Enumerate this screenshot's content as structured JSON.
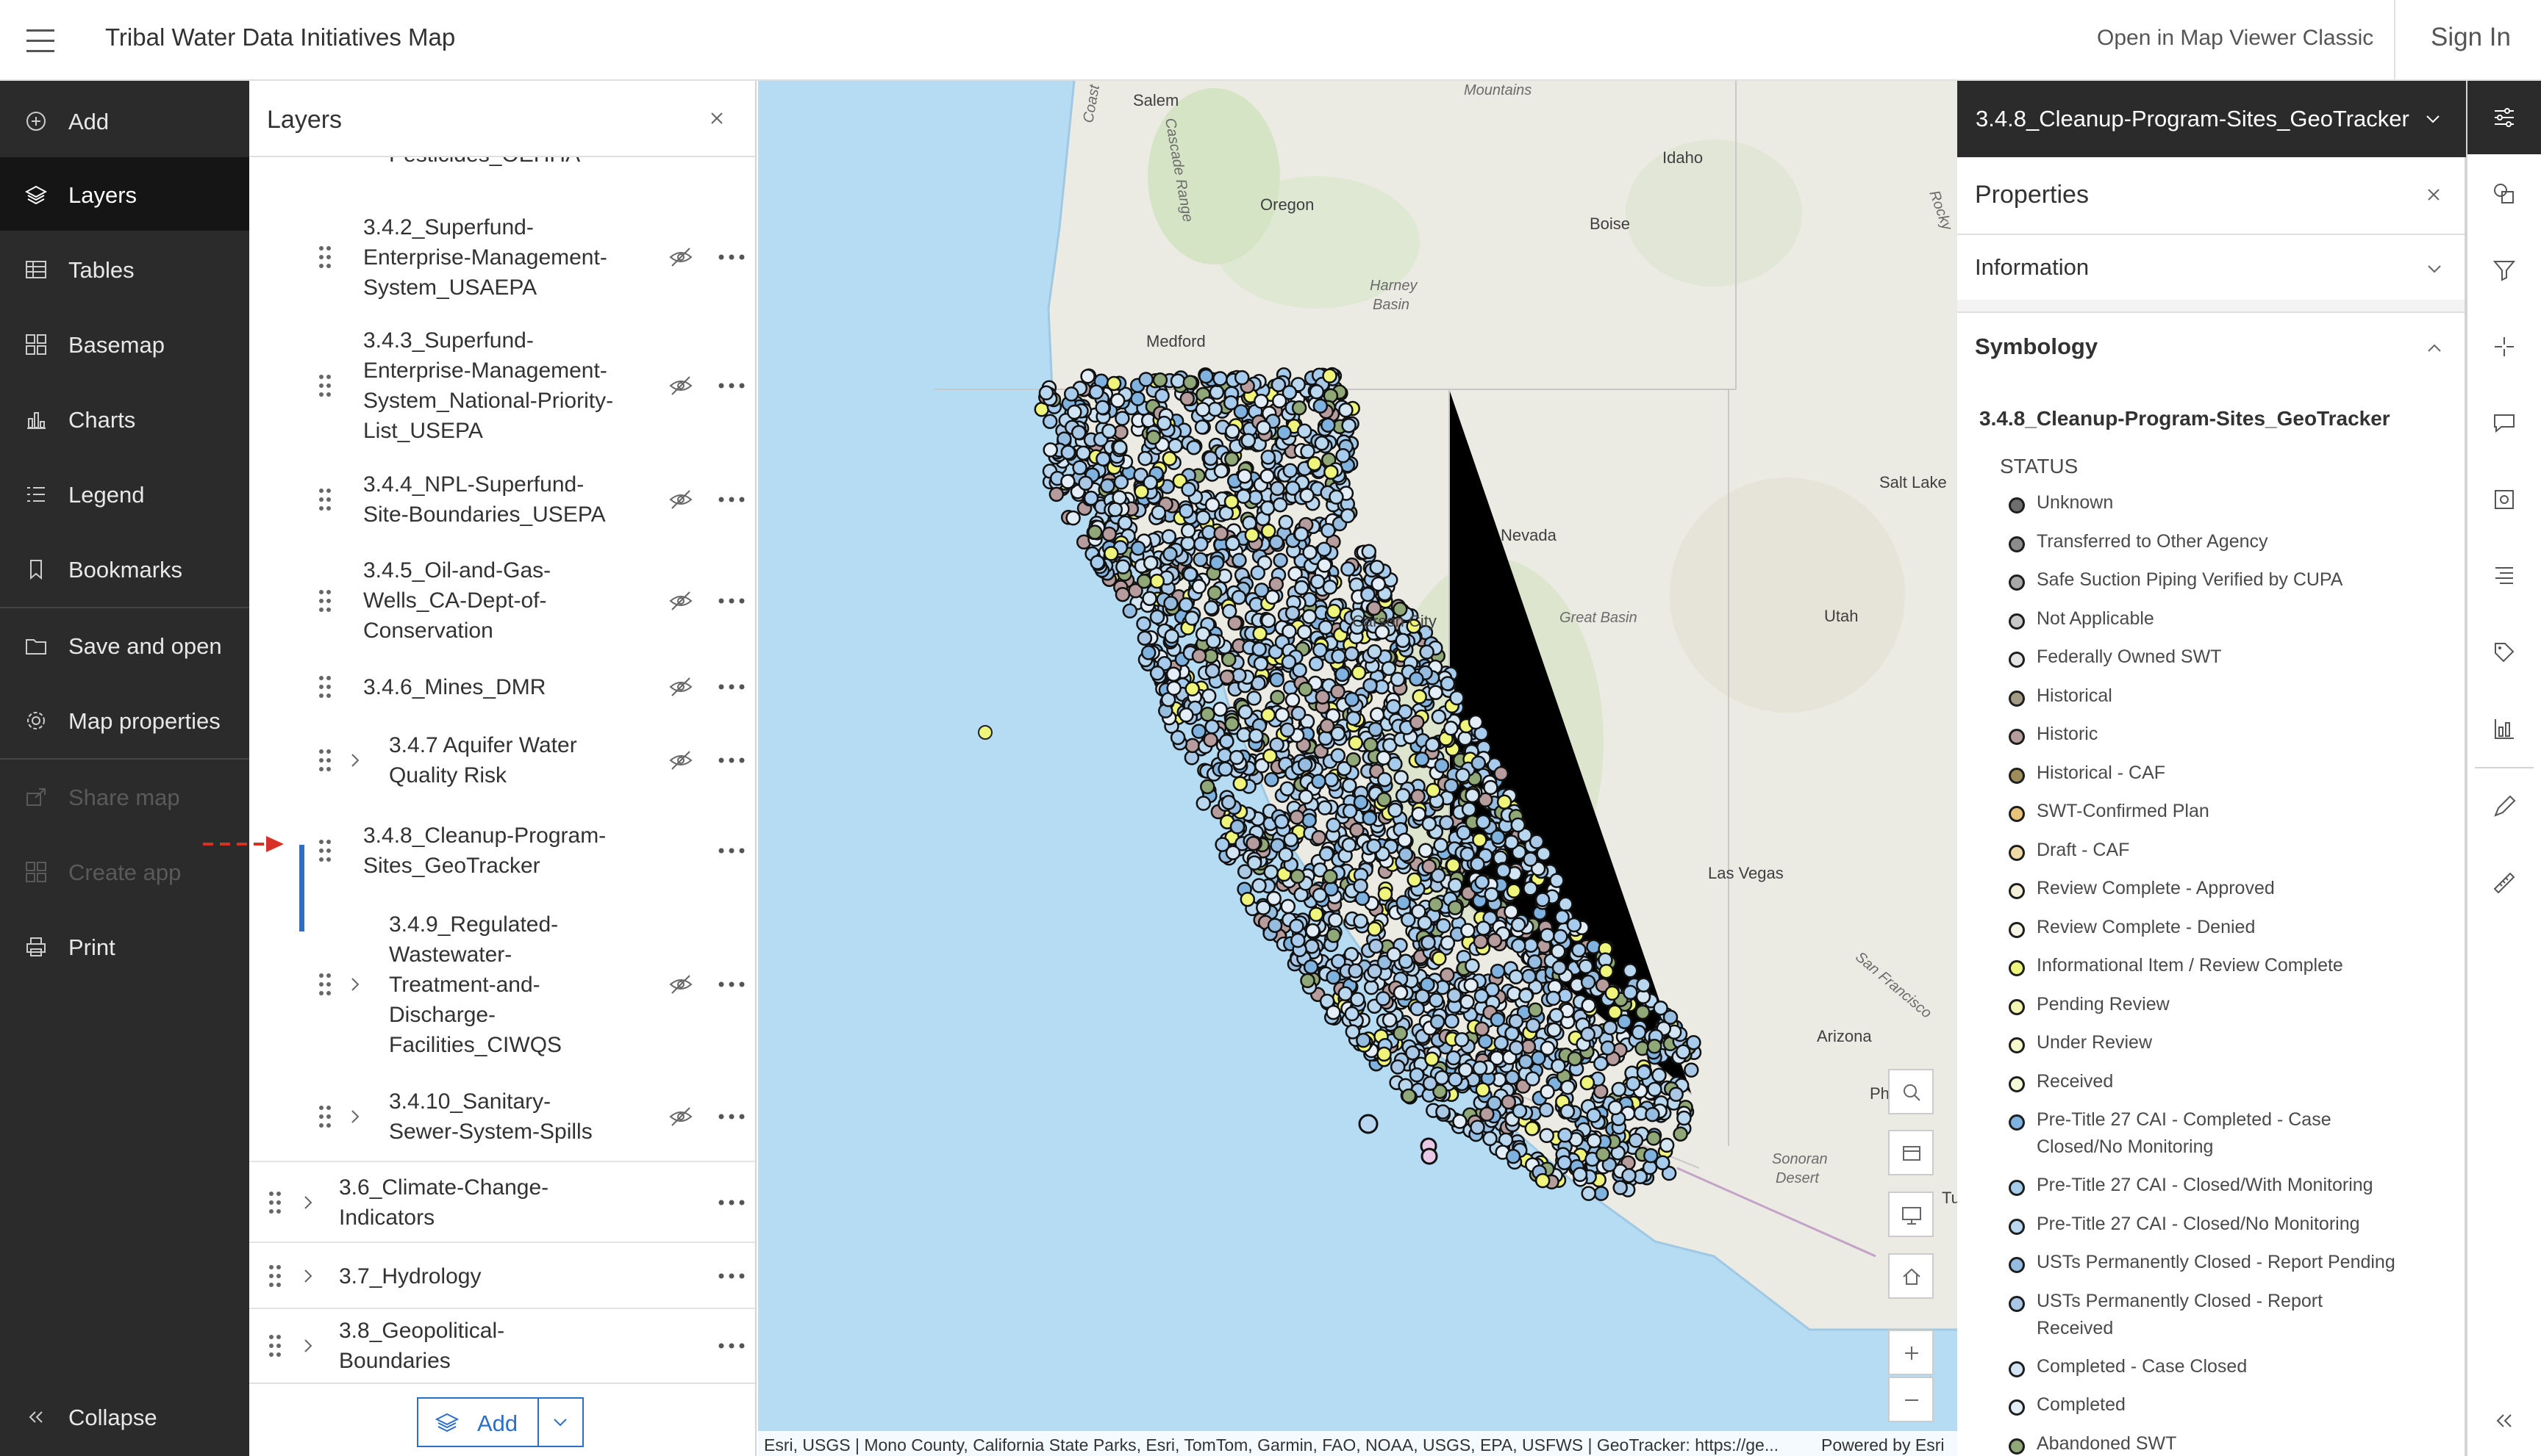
{
  "header": {
    "menu_icon": "hamburger-menu-icon",
    "title": "Tribal Water Data Initiatives Map",
    "classic_link": "Open in Map Viewer Classic",
    "sign_in": "Sign In"
  },
  "leftnav": {
    "items": [
      {
        "label": "Add",
        "icon": "add-circle-icon"
      },
      {
        "label": "Layers",
        "icon": "layers-icon",
        "active": true
      },
      {
        "label": "Tables",
        "icon": "table-icon"
      },
      {
        "label": "Basemap",
        "icon": "basemap-grid-icon"
      },
      {
        "label": "Charts",
        "icon": "bar-chart-icon"
      },
      {
        "label": "Legend",
        "icon": "legend-list-icon"
      },
      {
        "label": "Bookmarks",
        "icon": "bookmark-icon"
      },
      {
        "label": "Save and open",
        "icon": "folder-icon"
      },
      {
        "label": "Map properties",
        "icon": "gear-icon"
      },
      {
        "label": "Share map",
        "icon": "share-icon",
        "disabled": true
      },
      {
        "label": "Create app",
        "icon": "apps-icon",
        "disabled": true
      },
      {
        "label": "Print",
        "icon": "print-icon"
      }
    ],
    "collapse": "Collapse"
  },
  "layers": {
    "title": "Layers",
    "partial_top": "Pesticides_OEHHA",
    "items": [
      {
        "lines": [
          "3.4.2_Superfund-",
          "Enterprise-Management-",
          "System_USAEPA"
        ]
      },
      {
        "lines": [
          "3.4.3_Superfund-",
          "Enterprise-Management-",
          "System_National-Priority-",
          "List_USEPA"
        ]
      },
      {
        "lines": [
          "3.4.4_NPL-Superfund-",
          "Site-Boundaries_USEPA"
        ]
      },
      {
        "lines": [
          "3.4.5_Oil-and-Gas-",
          "Wells_CA-Dept-of-",
          "Conservation"
        ]
      },
      {
        "lines": [
          "3.4.6_Mines_DMR"
        ]
      },
      {
        "lines": [
          "3.4.7 Aquifer Water",
          "Quality Risk"
        ]
      },
      {
        "lines": [
          "3.4.8_Cleanup-Program-",
          "Sites_GeoTracker"
        ]
      },
      {
        "lines": [
          "3.4.9_Regulated-",
          "Wastewater-",
          "Treatment-and-",
          "Discharge-",
          "Facilities_CIWQS"
        ]
      },
      {
        "lines": [
          "3.4.10_Sanitary-",
          "Sewer-System-Spills"
        ]
      },
      {
        "lines": [
          "3.6_Climate-Change-",
          "Indicators"
        ]
      },
      {
        "lines": [
          "3.7_Hydrology"
        ]
      },
      {
        "lines": [
          "3.8_Geopolitical-",
          "Boundaries"
        ]
      }
    ],
    "add_button": "Add"
  },
  "map": {
    "labels": [
      "Salem",
      "Oregon",
      "Idaho",
      "Boise",
      "Mountains",
      "Harney",
      "Basin",
      "Medford",
      "Nevada",
      "Carson City",
      "Great Basin",
      "Utah",
      "Salt Lake",
      "Las Vegas",
      "Arizona",
      "Sonoran",
      "Desert",
      "Ph",
      "Tu",
      "San Francisco",
      "Rocky",
      "Coast",
      "Cascade Range"
    ],
    "attribution": "Esri, USGS | Mono County, California State Parks, Esri, TomTom, Garmin, FAO, NOAA, USGS, EPA, USFWS | GeoTracker: https://ge...",
    "powered_by": "Powered by Esri"
  },
  "right_panel": {
    "layer_title": "3.4.8_Cleanup-Program-Sites_GeoTracker",
    "properties_title": "Properties",
    "information": "Information",
    "symbology": "Symbology",
    "symbology_layer": "3.4.8_Cleanup-Program-Sites_GeoTracker",
    "field": "STATUS",
    "legend": [
      {
        "label": "Unknown",
        "color": "#6e6e6e"
      },
      {
        "label": "Transferred to Other Agency",
        "color": "#8c8c8c"
      },
      {
        "label": "Safe Suction Piping Verified by CUPA",
        "color": "#a8a8a8"
      },
      {
        "label": "Not Applicable",
        "color": "#c8c8c8"
      },
      {
        "label": "Federally Owned SWT",
        "color": "#e4e4e4"
      },
      {
        "label": "Historical",
        "color": "#a39b86"
      },
      {
        "label": "Historic",
        "color": "#b79c9e"
      },
      {
        "label": "Historical - CAF",
        "color": "#9e8d5b"
      },
      {
        "label": "SWT-Confirmed Plan",
        "color": "#e8c37a"
      },
      {
        "label": "Draft - CAF",
        "color": "#f0dba8"
      },
      {
        "label": "Review Complete - Approved",
        "color": "#f4efd8"
      },
      {
        "label": "Review Complete - Denied",
        "color": "#f7f4e5"
      },
      {
        "label": "Informational Item / Review Complete",
        "color": "#eef57a"
      },
      {
        "label": "Pending Review",
        "color": "#f3f6b2"
      },
      {
        "label": "Under Review",
        "color": "#f5f8cc"
      },
      {
        "label": "Received",
        "color": "#f6f9d8"
      },
      {
        "label": "Pre-Title 27 CAI - Completed - Case Closed/No Monitoring",
        "color": "#7fb2de",
        "two_line": true
      },
      {
        "label": "Pre-Title 27 CAI - Closed/With Monitoring",
        "color": "#a6cbec"
      },
      {
        "label": "Pre-Title 27 CAI - Closed/No Monitoring",
        "color": "#bad7f0"
      },
      {
        "label": "USTs Permanently Closed - Report Pending",
        "color": "#96bde0"
      },
      {
        "label": "USTs Permanently Closed - Report Received",
        "color": "#aac8e6",
        "two_line": true
      },
      {
        "label": "Completed - Case Closed",
        "color": "#d3e4f3"
      },
      {
        "label": "Completed",
        "color": "#e3eef8"
      },
      {
        "label": "Abandoned SWT",
        "color": "#90a878"
      }
    ]
  },
  "tools": [
    "properties-sliders-icon",
    "styles-icon",
    "filter-icon",
    "effects-icon",
    "pop-ups-icon",
    "fields-icon",
    "labels-icon",
    "label-tag-icon",
    "data-chart-icon",
    "sketch-icon",
    "measure-icon"
  ],
  "colors": {
    "accent": "#2a70c8",
    "nav_bg": "#2b2b2b",
    "water": "#b5dcf2",
    "land": "#ecebe3",
    "annotation": "#d93025"
  }
}
